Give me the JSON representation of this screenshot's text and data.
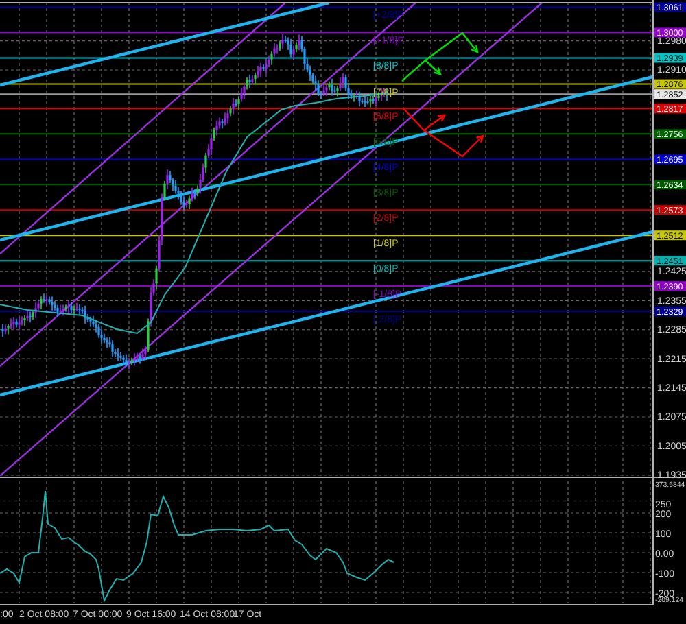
{
  "chart": {
    "price_axis": [
      "1.2980",
      "1.2910",
      "1.2425",
      "1.2355",
      "1.2285",
      "1.2215",
      "1.2145",
      "1.2075",
      "1.2005",
      "1.1935"
    ],
    "levels": [
      {
        "label": "[+2/8]P",
        "value": "1.3061",
        "color": "#0000a0"
      },
      {
        "label": "[+1/8]P",
        "value": "1.3000",
        "color": "#9400d3"
      },
      {
        "label": "[8/8]P",
        "value": "1.2939",
        "color": "#00c8c8"
      },
      {
        "label": "[7/8]P",
        "value": "1.2876",
        "color": "#c8c800"
      },
      {
        "label": "[6/8]P",
        "value": "1.2817",
        "color": "#e00000"
      },
      {
        "label": "[5/8]P",
        "value": "1.2756",
        "color": "#006400"
      },
      {
        "label": "[4/8]P",
        "value": "1.2695",
        "color": "#0000d0"
      },
      {
        "label": "[3/8]P",
        "value": "1.2634",
        "color": "#005a00"
      },
      {
        "label": "[2/8]P",
        "value": "1.2573",
        "color": "#c80000"
      },
      {
        "label": "[1/8]P",
        "value": "1.2512",
        "color": "#c8c800"
      },
      {
        "label": "[0/8]P",
        "value": "1.2451",
        "color": "#00b4b4"
      },
      {
        "label": "[-1/8]P",
        "value": "1.2390",
        "color": "#8c00c8"
      },
      {
        "label": "[-2/8]P",
        "value": "1.2329",
        "color": "#000090"
      }
    ],
    "current_price": "1.2852",
    "time_axis": [
      ":00",
      "2 Oct 08:00",
      "7 Oct 00:00",
      "9 Oct 16:00",
      "14 Oct 08:00",
      "17 Oct"
    ]
  },
  "indicator": {
    "axis": [
      {
        "text": "373.6844",
        "kind": "max"
      },
      {
        "text": "250",
        "kind": "tick"
      },
      {
        "text": "200",
        "kind": "tick"
      },
      {
        "text": "100",
        "kind": "tick"
      },
      {
        "text": "0.00",
        "kind": "tick"
      },
      {
        "text": "-100",
        "kind": "tick"
      },
      {
        "text": "-200",
        "kind": "tick"
      },
      {
        "text": "-209.124",
        "kind": "min"
      }
    ]
  }
}
